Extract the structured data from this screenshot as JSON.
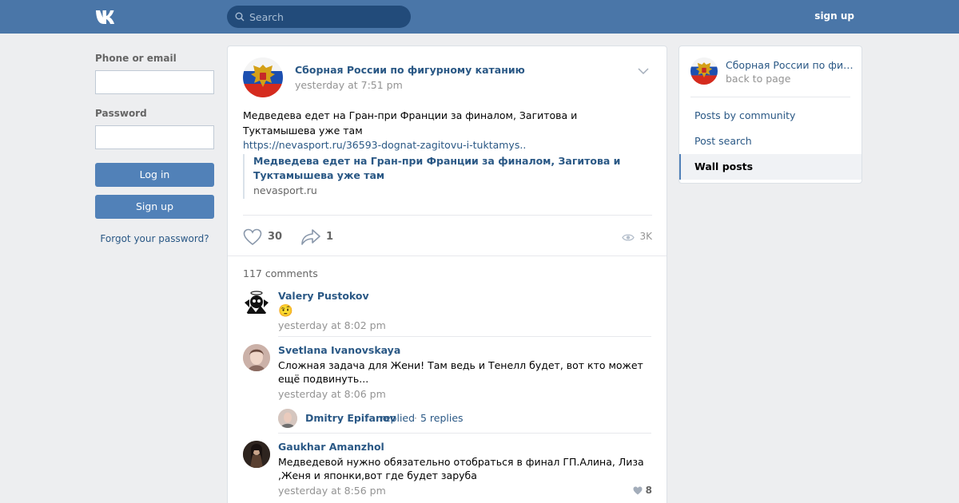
{
  "header": {
    "logo_icon": "vk-logo-icon",
    "search_placeholder": "Search",
    "signup_label": "sign up"
  },
  "login": {
    "phone_label": "Phone or email",
    "password_label": "Password",
    "login_button": "Log in",
    "signup_button": "Sign up",
    "forgot_link": "Forgot your password?"
  },
  "post": {
    "author": "Сборная России по фигурному катанию",
    "time": "yesterday at 7:51 pm",
    "text": "Медведева едет на Гран-при Франции за финалом, Загитова и Туктамышева уже там",
    "url": "https://nevasport.ru/36593-dognat-zagitovu-i-tuktamys..",
    "snippet_title": "Медведева едет на Гран-при Франции за финалом, Загитова и Туктамышева уже там",
    "snippet_domain": "nevasport.ru",
    "likes": "30",
    "shares": "1",
    "views": "3K",
    "comments_count": "117 comments"
  },
  "comments": [
    {
      "name": "Valery Pustokov",
      "text": "🤨",
      "time": "yesterday at 8:02 pm"
    },
    {
      "name": "Svetlana Ivanovskaya",
      "text": "Сложная задача для Жени! Там ведь и Тенелл будет, вот кто может ещё подвинуть...",
      "time": "yesterday at 8:06 pm",
      "reply": {
        "name": "Dmitry Epifanov",
        "action": "replied",
        "separator": "·",
        "count": "5 replies"
      }
    },
    {
      "name": "Gaukhar Amanzhol",
      "text": "Медведевой нужно обязательно отобраться в финал ГП.Алина, Лиза ,Женя и японки,вот где будет заруба",
      "time": "yesterday at 8:56 pm",
      "likes": "8"
    }
  ],
  "sidebar": {
    "community_name": "Сборная России по фигурному катанию",
    "back_label": "back to page",
    "items": [
      {
        "label": "Posts by community",
        "active": false
      },
      {
        "label": "Post search",
        "active": false
      },
      {
        "label": "Wall posts",
        "active": true
      }
    ]
  },
  "colors": {
    "header": "#4a76a8",
    "link": "#2a5885",
    "button": "#5181b8",
    "background": "#edeef0"
  }
}
